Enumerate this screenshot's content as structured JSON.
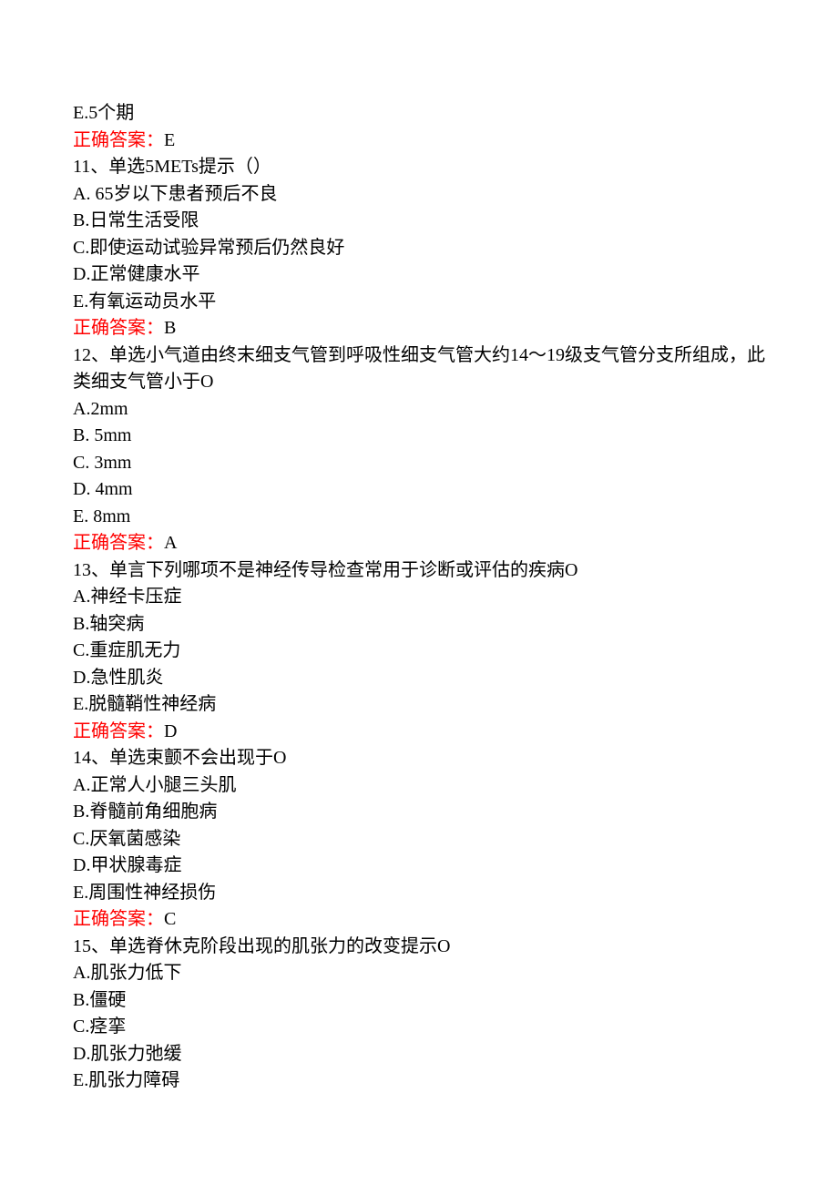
{
  "q10": {
    "optE": "E.5个期",
    "answerLabel": "正确答案：",
    "answerValue": "E"
  },
  "q11": {
    "stem": "11、单选5METs提示（）",
    "optA": "A. 65岁以下患者预后不良",
    "optB": "B.日常生活受限",
    "optC": "C.即使运动试验异常预后仍然良好",
    "optD": "D.正常健康水平",
    "optE": "E.有氧运动员水平",
    "answerLabel": "正确答案：",
    "answerValue": "B"
  },
  "q12": {
    "stem": "12、单选小气道由终末细支气管到呼吸性细支气管大约14～19级支气管分支所组成，此类细支气管小于O",
    "optA": "A.2mm",
    "optB": "B. 5mm",
    "optC": "C. 3mm",
    "optD": "D. 4mm",
    "optE": "E. 8mm",
    "answerLabel": "正确答案：",
    "answerValue": "A"
  },
  "q13": {
    "stem": "13、单言下列哪项不是神经传导检查常用于诊断或评估的疾病O",
    "optA": "A.神经卡压症",
    "optB": "B.轴突病",
    "optC": "C.重症肌无力",
    "optD": "D.急性肌炎",
    "optE": "E.脱髓鞘性神经病",
    "answerLabel": "正确答案：",
    "answerValue": "D"
  },
  "q14": {
    "stem": "14、单选束颤不会出现于O",
    "optA": "A.正常人小腿三头肌",
    "optB": "B.脊髓前角细胞病",
    "optC": "C.厌氧菌感染",
    "optD": "D.甲状腺毒症",
    "optE": "E.周围性神经损伤",
    "answerLabel": "正确答案：",
    "answerValue": "C"
  },
  "q15": {
    "stem": "15、单选脊休克阶段出现的肌张力的改变提示O",
    "optA": "A.肌张力低下",
    "optB": "B.僵硬",
    "optC": "C.痉挛",
    "optD": "D.肌张力弛缓",
    "optE": "E.肌张力障碍"
  }
}
